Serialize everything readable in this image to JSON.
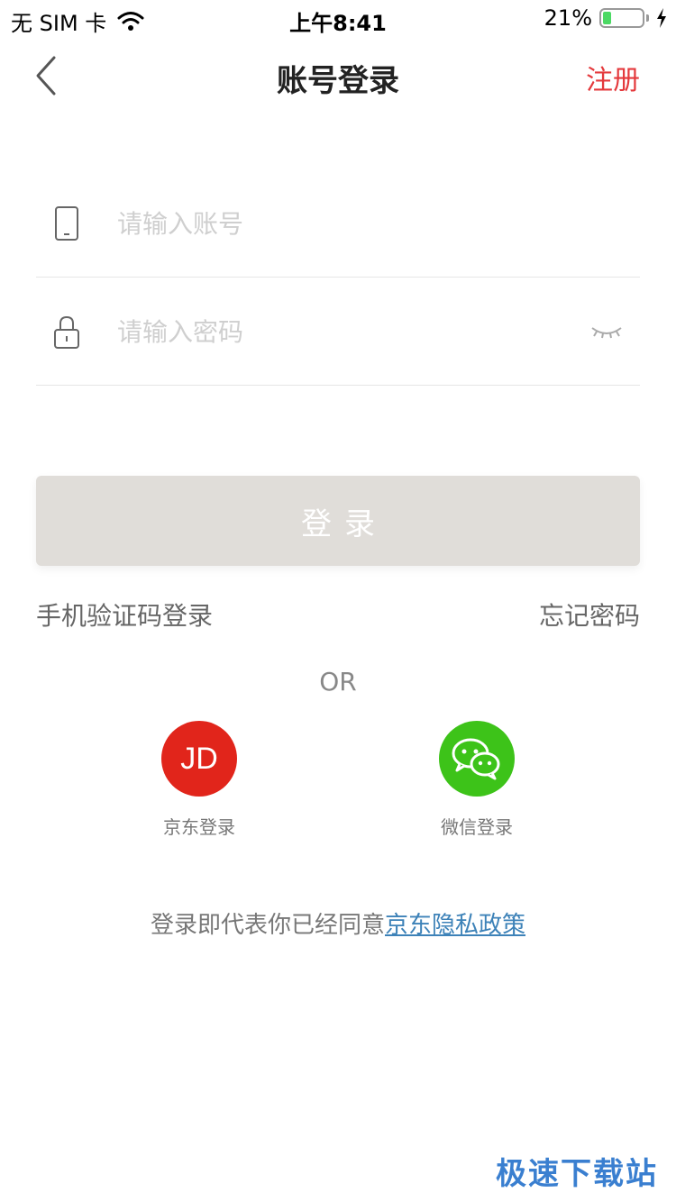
{
  "status_bar": {
    "carrier": "无 SIM 卡",
    "time": "上午8:41",
    "battery_percent_text": "21%",
    "battery_level": 0.21
  },
  "nav": {
    "title": "账号登录",
    "register_label": "注册"
  },
  "form": {
    "account_placeholder": "请输入账号",
    "password_placeholder": "请输入密码",
    "login_label": "登录"
  },
  "links": {
    "sms_login": "手机验证码登录",
    "forgot_password": "忘记密码"
  },
  "divider_text": "OR",
  "social": {
    "jd": {
      "logo_text": "JD",
      "label": "京东登录"
    },
    "wechat": {
      "label": "微信登录"
    }
  },
  "agreement": {
    "prefix": "登录即代表你已经同意",
    "link_text": "京东隐私政策"
  },
  "watermark": "极速下载站",
  "colors": {
    "accent_red": "#e4393c",
    "jd_red": "#e1251b",
    "wechat_green": "#3dc319",
    "link_blue": "#3d82b8",
    "disabled_button": "#e0ddd9"
  }
}
